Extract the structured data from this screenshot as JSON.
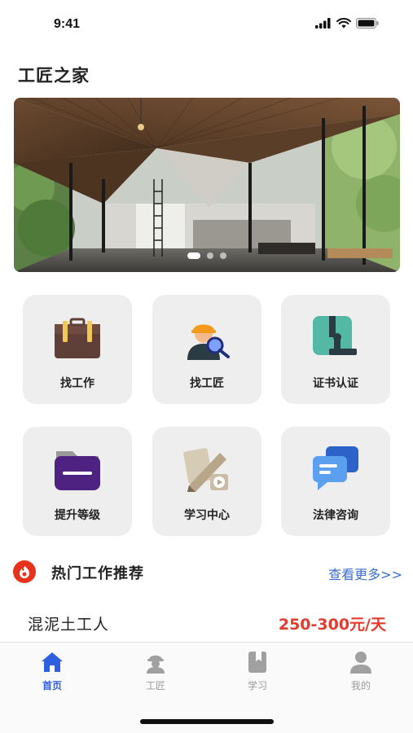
{
  "status_bar": {
    "time": "9:41",
    "icons": [
      "signal-icon",
      "wifi-icon",
      "battery-icon"
    ]
  },
  "app": {
    "title": "工匠之家"
  },
  "banner": {
    "image": "modern-house-interior-photo",
    "slides": 3,
    "active_slide": 1
  },
  "features": [
    {
      "label": "找工作",
      "icon": "briefcase-icon"
    },
    {
      "label": "找工匠",
      "icon": "worker-search-icon"
    },
    {
      "label": "证书认证",
      "icon": "certificate-stamp-icon"
    },
    {
      "label": "提升等级",
      "icon": "folder-icon"
    },
    {
      "label": "学习中心",
      "icon": "pencil-video-icon"
    },
    {
      "label": "法律咨询",
      "icon": "chat-bubbles-icon"
    }
  ],
  "hot_jobs": {
    "title": "热门工作推荐",
    "more": "查看更多>>",
    "items": [
      {
        "title": "混泥土工人",
        "pay": "250-300元/天"
      }
    ]
  },
  "tabbar": {
    "tabs": [
      {
        "label": "首页",
        "icon": "home-icon",
        "active": true
      },
      {
        "label": "工匠",
        "icon": "worker-icon",
        "active": false
      },
      {
        "label": "学习",
        "icon": "book-icon",
        "active": false
      },
      {
        "label": "我的",
        "icon": "person-icon",
        "active": false
      }
    ]
  },
  "colors": {
    "accent": "#2d5fe0",
    "price": "#e53b2c",
    "link": "#3d6cc9",
    "tile_bg": "#eeeeee",
    "hot_icon": "#e8331c"
  }
}
